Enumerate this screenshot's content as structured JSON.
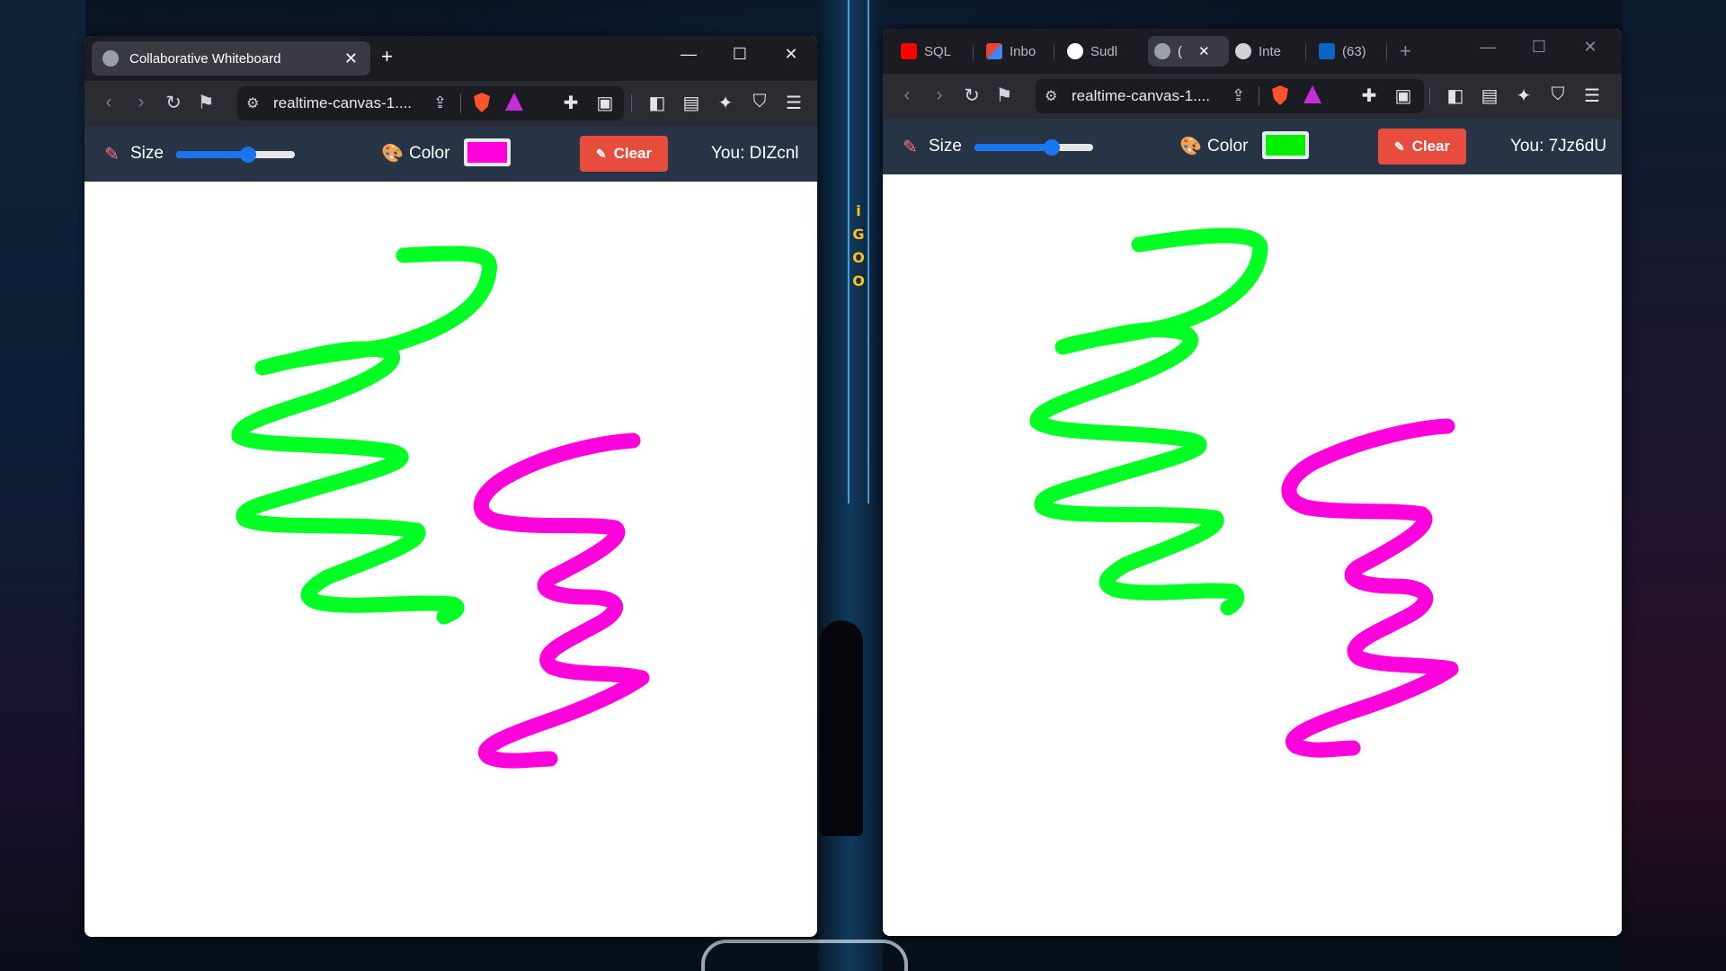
{
  "left_window": {
    "tab_title": "Collaborative Whiteboard",
    "tab_close": "✕",
    "new_tab": "+",
    "controls": {
      "minimize": "—",
      "maximize": "☐",
      "close": "✕"
    },
    "url": "realtime-canvas-1....",
    "toolbar": {
      "size_label": "Size",
      "size_value": 0.6,
      "color_label": "Color",
      "current_color": "#ff00dd",
      "clear_label": "Clear",
      "user_label": "You: DIZcnl"
    }
  },
  "right_window": {
    "tabs": [
      {
        "label": "SQL",
        "icon": "youtube-icon"
      },
      {
        "label": "Inbo",
        "icon": "gmail-icon"
      },
      {
        "label": "Sudl",
        "icon": "github-icon"
      },
      {
        "label": "(",
        "icon": "globe-icon",
        "active": true
      },
      {
        "label": "Inte",
        "icon": "openai-icon"
      },
      {
        "label": "(63)",
        "icon": "linkedin-icon"
      }
    ],
    "tab_close": "✕",
    "new_tab": "+",
    "controls": {
      "minimize": "—",
      "maximize": "☐",
      "close": "✕"
    },
    "url": "realtime-canvas-1....",
    "toolbar": {
      "size_label": "Size",
      "size_value": 0.65,
      "color_label": "Color",
      "current_color": "#00ee00",
      "clear_label": "Clear",
      "user_label": "You: 7Jz6dU"
    }
  },
  "strokes": [
    {
      "color": "#00ff22",
      "description": "green zigzag"
    },
    {
      "color": "#ff00dd",
      "description": "magenta zigzag"
    }
  ],
  "wallpaper": {
    "sign_text": "i GOO"
  }
}
